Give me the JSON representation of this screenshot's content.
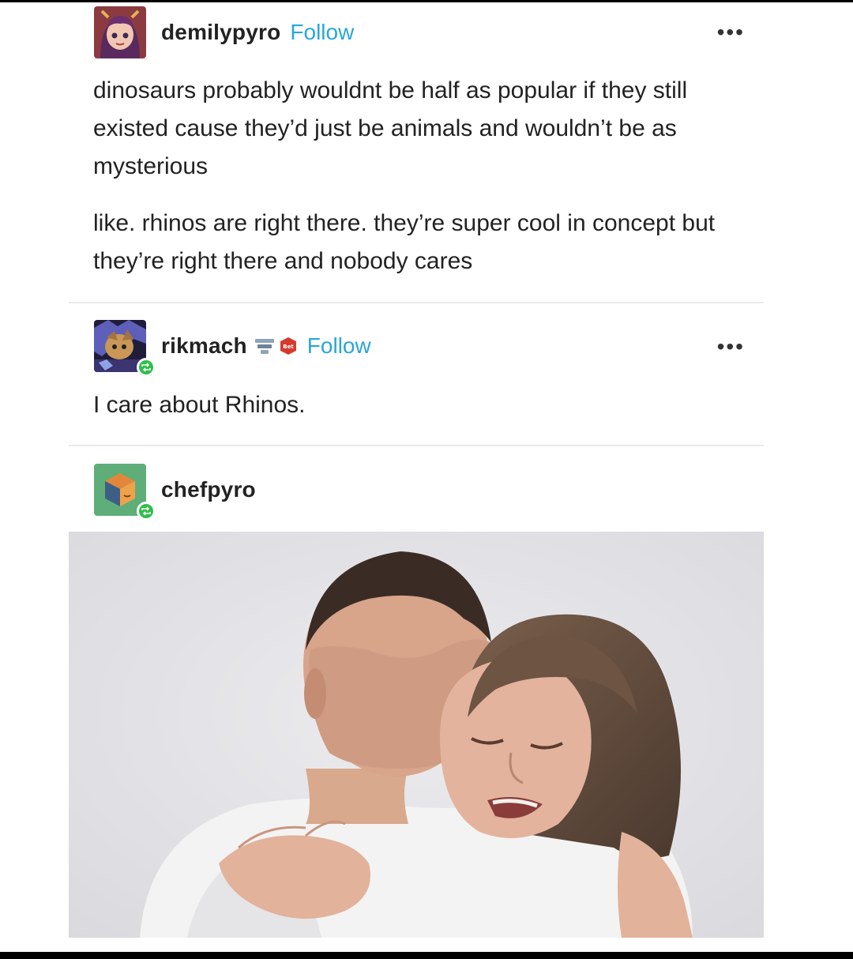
{
  "posts": [
    {
      "username": "demilypyro",
      "follow_label": "Follow",
      "more_label": "•••",
      "paragraphs": [
        "dinosaurs probably wouldnt be half as popular if they still existed cause they’d just be animals and wouldn’t be as mysterious",
        "like. rhinos are right there. they’re super cool in concept but they’re right there and nobody cares"
      ]
    },
    {
      "username": "rikmach",
      "follow_label": "Follow",
      "more_label": "•••",
      "badge_text": "Bet",
      "paragraphs": [
        "I care about Rhinos."
      ]
    },
    {
      "username": "chefpyro"
    }
  ],
  "colors": {
    "follow": "#2aa6d9",
    "reblog_badge": "#2fbf4a",
    "divider": "#eaeaea"
  },
  "icons": [
    "avatar-demilypyro",
    "avatar-rikmach",
    "avatar-chefpyro",
    "reblog-icon",
    "more-icon",
    "award-badge-icon"
  ]
}
